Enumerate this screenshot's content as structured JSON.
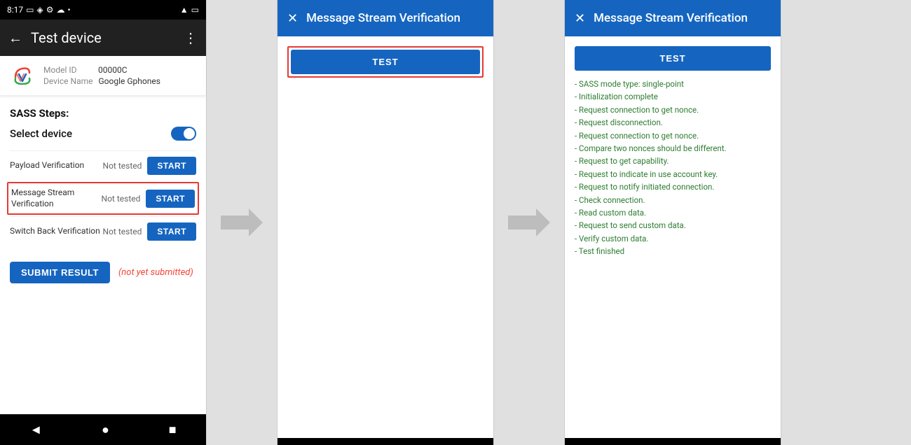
{
  "statusBar": {
    "time": "8:17",
    "icons": [
      "sim",
      "location",
      "settings",
      "wifi",
      "battery"
    ]
  },
  "appBar": {
    "title": "Test device",
    "backLabel": "←",
    "menuLabel": "⋮"
  },
  "deviceInfo": {
    "modelIdLabel": "Model ID",
    "modelIdValue": "00000C",
    "deviceNameLabel": "Device Name",
    "deviceNameValue": "Google Gphones"
  },
  "sass": {
    "title": "SASS Steps:",
    "selectDevice": "Select device",
    "steps": [
      {
        "label": "Payload Verification",
        "status": "Not tested",
        "btnLabel": "START"
      },
      {
        "label": "Message Stream Verification",
        "status": "Not tested",
        "btnLabel": "START",
        "highlighted": true
      },
      {
        "label": "Switch Back Verification",
        "status": "Not tested",
        "btnLabel": "START"
      }
    ]
  },
  "submit": {
    "btnLabel": "SUBMIT RESULT",
    "notSubmitted": "(not yet submitted)"
  },
  "bottomNav": {
    "back": "◄",
    "home": "●",
    "square": "■"
  },
  "dialog1": {
    "title": "Message Stream Verification",
    "closeIcon": "✕",
    "testBtnLabel": "TEST"
  },
  "dialog2": {
    "title": "Message Stream Verification",
    "closeIcon": "✕",
    "testBtnLabel": "TEST",
    "logLines": [
      "- SASS mode type: single-point",
      "- Initialization complete",
      "- Request connection to get nonce.",
      "- Request disconnection.",
      "- Request connection to get nonce.",
      "- Compare two nonces should be different.",
      "- Request to get capability.",
      "- Request to indicate in use account key.",
      "- Request to notify initiated connection.",
      "- Check connection.",
      "- Read custom data.",
      "- Request to send custom data.",
      "- Verify custom data.",
      "- Test finished"
    ]
  }
}
